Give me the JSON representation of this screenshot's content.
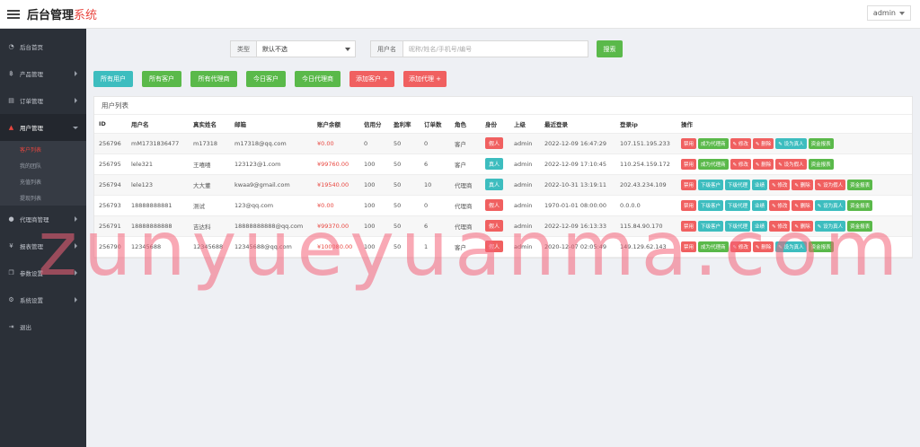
{
  "header": {
    "brand_main": "后台管理",
    "brand_accent": "系统",
    "user": "admin"
  },
  "sidebar": {
    "items": [
      {
        "label": "后台首页",
        "icon": "dashboard-icon",
        "glyph": "◔"
      },
      {
        "label": "产品管理",
        "icon": "bitcoin-icon",
        "glyph": "฿"
      },
      {
        "label": "订单管理",
        "icon": "order-icon",
        "glyph": "▤"
      },
      {
        "label": "用户管理",
        "icon": "user-icon",
        "glyph": "▲"
      },
      {
        "label": "代理商管理",
        "icon": "agent-icon",
        "glyph": "●"
      },
      {
        "label": "报表管理",
        "icon": "yen-icon",
        "glyph": "¥"
      },
      {
        "label": "参数设置",
        "icon": "copy-icon",
        "glyph": "❐"
      },
      {
        "label": "系统设置",
        "icon": "cogs-icon",
        "glyph": "⚙"
      },
      {
        "label": "退出",
        "icon": "logout-icon",
        "glyph": "⇥"
      }
    ],
    "sub_items": [
      "客户列表",
      "我的团队",
      "充值列表",
      "提现列表"
    ]
  },
  "search": {
    "type_label": "类型",
    "type_value": "默认不选",
    "user_label": "用户名",
    "user_placeholder": "昵称/姓名/手机号/编号",
    "button": "搜索"
  },
  "filters": [
    {
      "label": "所有用户",
      "color": "#3dbdbf"
    },
    {
      "label": "所有客户",
      "color": "#5ab94a"
    },
    {
      "label": "所有代理商",
      "color": "#5ab94a"
    },
    {
      "label": "今日客户",
      "color": "#5ab94a"
    },
    {
      "label": "今日代理商",
      "color": "#5ab94a"
    },
    {
      "label": "添加客户 +",
      "color": "#f06060"
    },
    {
      "label": "添加代理 +",
      "color": "#f06060"
    }
  ],
  "panel_title": "用户列表",
  "table": {
    "headers": [
      "ID",
      "用户名",
      "真实姓名",
      "邮箱",
      "账户余额",
      "信用分",
      "盈利率",
      "订单数",
      "角色",
      "身份",
      "上级",
      "最近登录",
      "登录ip",
      "操作"
    ],
    "rows": [
      {
        "id": "256796",
        "username": "mM1731836477",
        "realname": "m17318",
        "email": "m17318@qq.com",
        "balance": "¥0.00",
        "credit": "0",
        "profit": "50",
        "orders": "0",
        "role": "客户",
        "identity": "假人",
        "identity_color": "#f06060",
        "parent": "admin",
        "last_login": "2022-12-09 16:47:29",
        "ip": "107.151.195.233",
        "actions": [
          {
            "label": "禁用",
            "color": "#f06060"
          },
          {
            "label": "成为代理商",
            "color": "#5ab94a"
          },
          {
            "label": "✎ 修改",
            "color": "#f06060"
          },
          {
            "label": "✎ 删除",
            "color": "#f06060"
          },
          {
            "label": "✎ 设为真人",
            "color": "#3dbdbf"
          },
          {
            "label": "资金报表",
            "color": "#5ab94a"
          }
        ]
      },
      {
        "id": "256795",
        "username": "lele321",
        "realname": "王嘻嘻",
        "email": "123123@1.com",
        "balance": "¥99760.00",
        "credit": "100",
        "profit": "50",
        "orders": "6",
        "role": "客户",
        "identity": "真人",
        "identity_color": "#3dbdbf",
        "parent": "admin",
        "last_login": "2022-12-09 17:10:45",
        "ip": "110.254.159.172",
        "actions": [
          {
            "label": "禁用",
            "color": "#f06060"
          },
          {
            "label": "成为代理商",
            "color": "#5ab94a"
          },
          {
            "label": "✎ 修改",
            "color": "#f06060"
          },
          {
            "label": "✎ 删除",
            "color": "#f06060"
          },
          {
            "label": "✎ 设为假人",
            "color": "#f06060"
          },
          {
            "label": "资金报表",
            "color": "#5ab94a"
          }
        ]
      },
      {
        "id": "256794",
        "username": "lele123",
        "realname": "大大董",
        "email": "kwaa9@gmail.com",
        "balance": "¥19540.00",
        "credit": "100",
        "profit": "50",
        "orders": "10",
        "role": "代理商",
        "identity": "真人",
        "identity_color": "#3dbdbf",
        "parent": "admin",
        "last_login": "2022-10-31 13:19:11",
        "ip": "202.43.234.109",
        "actions": [
          {
            "label": "禁用",
            "color": "#f06060"
          },
          {
            "label": "下级客户",
            "color": "#3dbdbf"
          },
          {
            "label": "下级代理",
            "color": "#3dbdbf"
          },
          {
            "label": "业绩",
            "color": "#3dbdbf"
          },
          {
            "label": "✎ 修改",
            "color": "#f06060"
          },
          {
            "label": "✎ 删除",
            "color": "#f06060"
          },
          {
            "label": "✎ 设为假人",
            "color": "#f06060"
          },
          {
            "label": "资金报表",
            "color": "#5ab94a"
          }
        ]
      },
      {
        "id": "256793",
        "username": "18888888881",
        "realname": "测试",
        "email": "123@qq.com",
        "balance": "¥0.00",
        "credit": "100",
        "profit": "50",
        "orders": "0",
        "role": "代理商",
        "identity": "假人",
        "identity_color": "#f06060",
        "parent": "admin",
        "last_login": "1970-01-01 08:00:00",
        "ip": "0.0.0.0",
        "actions": [
          {
            "label": "禁用",
            "color": "#f06060"
          },
          {
            "label": "下级客户",
            "color": "#3dbdbf"
          },
          {
            "label": "下级代理",
            "color": "#3dbdbf"
          },
          {
            "label": "业绩",
            "color": "#3dbdbf"
          },
          {
            "label": "✎ 修改",
            "color": "#f06060"
          },
          {
            "label": "✎ 删除",
            "color": "#f06060"
          },
          {
            "label": "✎ 设为真人",
            "color": "#3dbdbf"
          },
          {
            "label": "资金报表",
            "color": "#5ab94a"
          }
        ]
      },
      {
        "id": "256791",
        "username": "18888888888",
        "realname": "吉达科",
        "email": "18888888888@qq.com",
        "balance": "¥99370.00",
        "credit": "100",
        "profit": "50",
        "orders": "6",
        "role": "代理商",
        "identity": "假人",
        "identity_color": "#f06060",
        "parent": "admin",
        "last_login": "2022-12-09 16:13:33",
        "ip": "115.84.90.170",
        "actions": [
          {
            "label": "禁用",
            "color": "#f06060"
          },
          {
            "label": "下级客户",
            "color": "#3dbdbf"
          },
          {
            "label": "下级代理",
            "color": "#3dbdbf"
          },
          {
            "label": "业绩",
            "color": "#3dbdbf"
          },
          {
            "label": "✎ 修改",
            "color": "#f06060"
          },
          {
            "label": "✎ 删除",
            "color": "#f06060"
          },
          {
            "label": "✎ 设为真人",
            "color": "#3dbdbf"
          },
          {
            "label": "资金报表",
            "color": "#5ab94a"
          }
        ]
      },
      {
        "id": "256790",
        "username": "12345688",
        "realname": "12345688",
        "email": "12345688@qq.com",
        "balance": "¥100080.00",
        "credit": "100",
        "profit": "50",
        "orders": "1",
        "role": "客户",
        "identity": "假人",
        "identity_color": "#f06060",
        "parent": "admin",
        "last_login": "2020-12-07 02:05:49",
        "ip": "149.129.62.143",
        "actions": [
          {
            "label": "禁用",
            "color": "#f06060"
          },
          {
            "label": "成为代理商",
            "color": "#5ab94a"
          },
          {
            "label": "✎ 修改",
            "color": "#f06060"
          },
          {
            "label": "✎ 删除",
            "color": "#f06060"
          },
          {
            "label": "✎ 设为真人",
            "color": "#3dbdbf"
          },
          {
            "label": "资金报表",
            "color": "#5ab94a"
          }
        ]
      }
    ]
  },
  "watermark": "zunyueyuanma.com"
}
